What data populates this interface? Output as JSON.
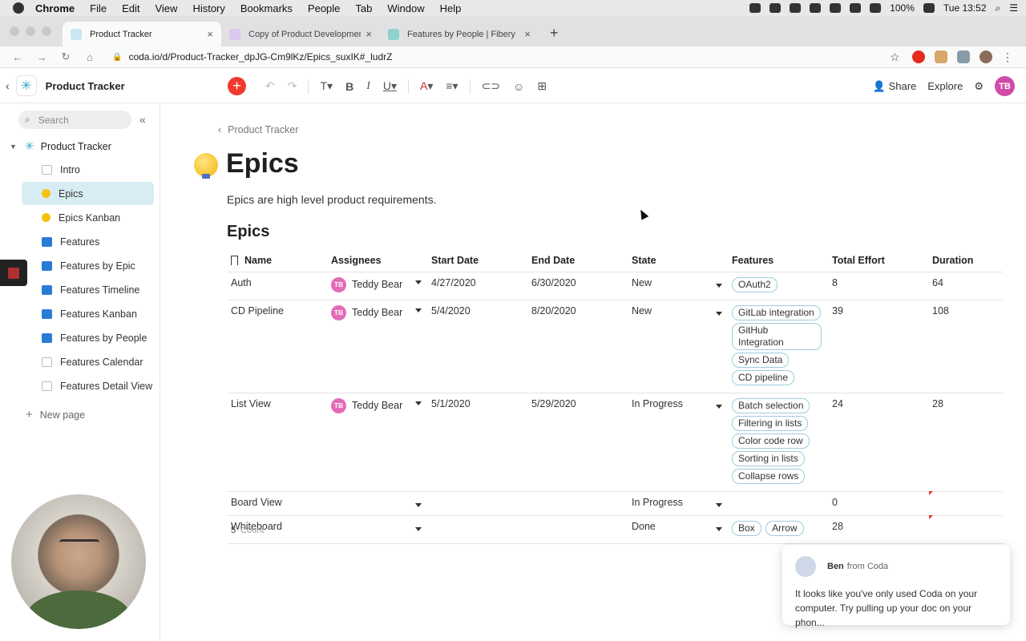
{
  "menubar": {
    "app": "Chrome",
    "items": [
      "File",
      "Edit",
      "View",
      "History",
      "Bookmarks",
      "People",
      "Tab",
      "Window",
      "Help"
    ],
    "battery": "100%",
    "clock": "Tue 13:52"
  },
  "tabs": [
    {
      "title": "Product Tracker",
      "active": true
    },
    {
      "title": "Copy of Product Development",
      "active": false
    },
    {
      "title": "Features by People | Fibery",
      "active": false
    }
  ],
  "address": {
    "url": "coda.io/d/Product-Tracker_dpJG-Cm9lKz/Epics_suxIK#_ludrZ"
  },
  "header": {
    "doc_title": "Product Tracker",
    "share": "Share",
    "explore": "Explore",
    "avatar": "TB"
  },
  "sidebar": {
    "search_placeholder": "Search",
    "root": "Product Tracker",
    "items": [
      {
        "label": "Intro",
        "icon": "page"
      },
      {
        "label": "Epics",
        "icon": "bulb",
        "active": true
      },
      {
        "label": "Epics Kanban",
        "icon": "bulb"
      },
      {
        "label": "Features",
        "icon": "block"
      },
      {
        "label": "Features by Epic",
        "icon": "block"
      },
      {
        "label": "Features Timeline",
        "icon": "block"
      },
      {
        "label": "Features Kanban",
        "icon": "block"
      },
      {
        "label": "Features by People",
        "icon": "block"
      },
      {
        "label": "Features Calendar",
        "icon": "page"
      },
      {
        "label": "Features Detail View",
        "icon": "page"
      }
    ],
    "new_page": "New page"
  },
  "page": {
    "breadcrumb": "Product Tracker",
    "title": "Epics",
    "description": "Epics are high level product requirements.",
    "table_heading": "Epics"
  },
  "table": {
    "columns": [
      "Name",
      "Assignees",
      "Start Date",
      "End Date",
      "State",
      "Features",
      "Total Effort",
      "Duration"
    ],
    "rows": [
      {
        "name": "Auth",
        "assignee": "Teddy Bear",
        "assignee_initials": "TB",
        "start": "4/27/2020",
        "end": "6/30/2020",
        "state": "New",
        "features": [
          "OAuth2"
        ],
        "effort": "8",
        "duration": "64"
      },
      {
        "name": "CD Pipeline",
        "assignee": "Teddy Bear",
        "assignee_initials": "TB",
        "start": "5/4/2020",
        "end": "8/20/2020",
        "state": "New",
        "features": [
          "GitLab integration",
          "GitHub Integration",
          "Sync Data",
          "CD pipeline"
        ],
        "effort": "39",
        "duration": "108"
      },
      {
        "name": "List View",
        "assignee": "Teddy Bear",
        "assignee_initials": "TB",
        "start": "5/1/2020",
        "end": "5/29/2020",
        "state": "In Progress",
        "features": [
          "Batch selection",
          "Filtering in lists",
          "Color code row",
          "Sorting in lists",
          "Collapse rows"
        ],
        "effort": "24",
        "duration": "28"
      },
      {
        "name": "Board View",
        "assignee": "",
        "assignee_initials": "",
        "start": "",
        "end": "",
        "state": "In Progress",
        "features": [],
        "effort": "0",
        "duration": ""
      },
      {
        "name": "Whiteboard",
        "assignee": "",
        "assignee_initials": "",
        "start": "",
        "end": "",
        "state": "Done",
        "features": [
          "Box",
          "Arrow"
        ],
        "effort": "28",
        "duration": ""
      }
    ],
    "count": "5",
    "count_label": "Count"
  },
  "toast": {
    "sender": "Ben",
    "source": "from Coda",
    "message": "It looks like you've only used Coda on your computer. Try pulling up your doc on your phon..."
  }
}
